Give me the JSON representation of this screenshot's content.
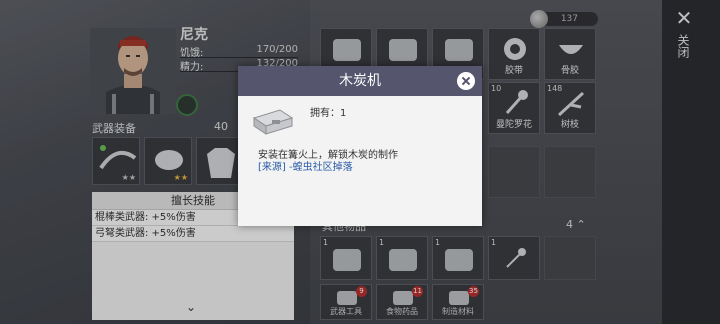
{
  "character": {
    "name": "尼克",
    "stats": [
      {
        "label": "饥饿:",
        "value": "170/200"
      },
      {
        "label": "精力:",
        "value": "132/200"
      }
    ]
  },
  "weapons": {
    "title": "武器装备",
    "count": "40",
    "slots": [
      {
        "stars": "★★",
        "gold": false
      },
      {
        "stars": "★★",
        "gold": true
      },
      {
        "stars": "",
        "gold": false
      }
    ]
  },
  "skills": {
    "title": "擅长技能",
    "lines": [
      "棍棒类武器: +5%伤害",
      "弓弩类武器: +5%伤害"
    ]
  },
  "inventory": {
    "money": "137",
    "top_row": [
      {
        "count": "",
        "label": ""
      },
      {
        "count": "",
        "label": ""
      },
      {
        "count": "",
        "label": ""
      },
      {
        "count": "",
        "label": "胶带"
      },
      {
        "count": "",
        "label": "骨胶"
      }
    ],
    "mid_row": [
      {
        "count": "10",
        "label": "曼陀罗花"
      },
      {
        "count": "148",
        "label": "树枝"
      }
    ],
    "other_label": "其他物品",
    "other_count": "4",
    "other_row": [
      {
        "count": "1"
      },
      {
        "count": "1"
      },
      {
        "count": "1"
      },
      {
        "count": "1"
      }
    ],
    "tabs": [
      {
        "label": "武器工具",
        "badge": "9"
      },
      {
        "label": "食物药品",
        "badge": "11"
      },
      {
        "label": "制造材料",
        "badge": "35"
      }
    ]
  },
  "side": {
    "close_label": "关闭"
  },
  "modal": {
    "title": "木炭机",
    "owned": "拥有：1",
    "description": "安装在篝火上，解锁木炭的制作",
    "source": "[来源] -蝗虫社区掉落"
  },
  "colors": {
    "modal_header": "#56556e",
    "source_link": "#2a5ca8",
    "badge": "#b8302f"
  }
}
